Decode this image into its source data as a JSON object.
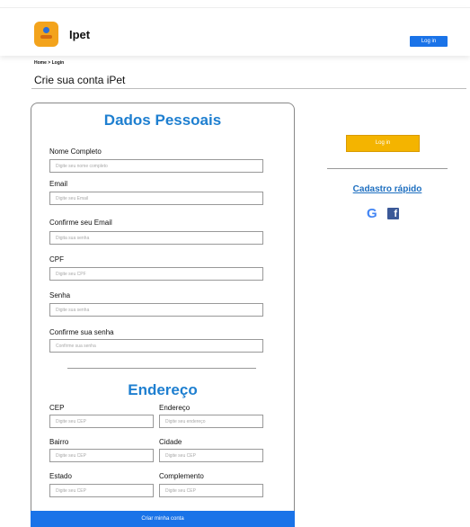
{
  "header": {
    "brand": "Ipet",
    "login_button": "Log in"
  },
  "breadcrumb": "Home > Login",
  "page_title": "Crie sua conta iPet",
  "personal": {
    "title": "Dados Pessoais",
    "fields": [
      {
        "label": "Nome Completo",
        "placeholder": "Digite seu nome completo"
      },
      {
        "label": "Email",
        "placeholder": "Digite seu Email"
      },
      {
        "label": "Confirme seu Email",
        "placeholder": "Digita sua senha"
      },
      {
        "label": "CPF",
        "placeholder": "Digite seu CPF"
      },
      {
        "label": "Senha",
        "placeholder": "Digite sua senha"
      },
      {
        "label": "Confirme sua senha",
        "placeholder": "Confirme sua senha"
      }
    ]
  },
  "address": {
    "title": "Endereço",
    "fields": [
      {
        "label": "CEP",
        "placeholder": "Digite seu CEP"
      },
      {
        "label": "Endereço",
        "placeholder": "Digite seu endereço"
      },
      {
        "label": "Bairro",
        "placeholder": "Digite seu CEP"
      },
      {
        "label": "Cidade",
        "placeholder": "Digite seu CEP"
      },
      {
        "label": "Estado",
        "placeholder": "Digite seu CEP"
      },
      {
        "label": "Complemento",
        "placeholder": "Digite seu CEP"
      }
    ]
  },
  "submit_label": "Criar minha conta",
  "sidebar": {
    "login_button": "Log in",
    "quick_signup": "Cadastro rápido",
    "google_icon": "G",
    "facebook_icon": "f"
  },
  "colors": {
    "accent_blue": "#1a73e8",
    "title_blue": "#1e7fd0",
    "login_yellow": "#f4b400",
    "logo_orange": "#f3a31c",
    "facebook": "#3b5998",
    "google_red": "#ea4335"
  }
}
